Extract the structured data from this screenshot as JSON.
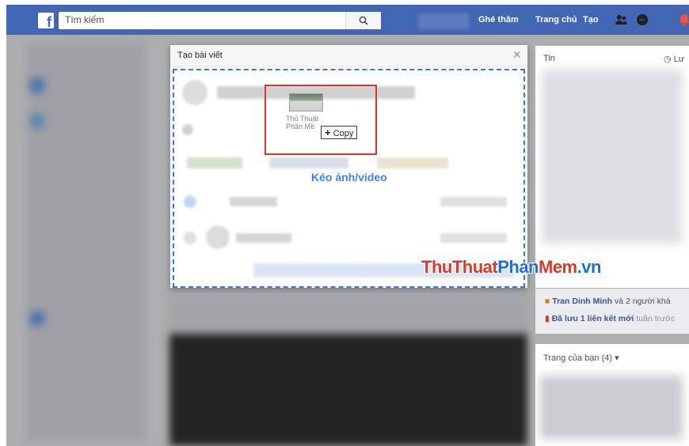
{
  "topbar": {
    "search_placeholder": "Tìm kiếm",
    "nav_explore": "Ghé thăm",
    "nav_home": "Trang chủ",
    "nav_create": "Tạo"
  },
  "dialog": {
    "title": "Tạo bài viết",
    "close": "×",
    "drop_label": "Kéo ảnh/video",
    "dragged_file_name_line1": "Thủ Thuật",
    "dragged_file_name_line2": "Phần Mề",
    "copy_tooltip": "Copy"
  },
  "watermark": {
    "part1": "ThuThuat",
    "part2": "Phan",
    "part3": "Mem",
    "part4": ".vn"
  },
  "right": {
    "stories_title": "Tin",
    "stories_action": "Lư",
    "notif_name": "Tran Dinh Minh",
    "notif_rest": " và 2 người khá",
    "saved_text": "Đã lưu 1 liên kết mới",
    "saved_rest": " tuần trước",
    "pages_title": "Trang của bạn (4) ▾"
  },
  "colors": {
    "brand": "#4267b2",
    "accent": "#4080ff",
    "highlight": "#e0322b",
    "watermark_red": "#d63a2c",
    "watermark_blue": "#1d6fd6"
  }
}
